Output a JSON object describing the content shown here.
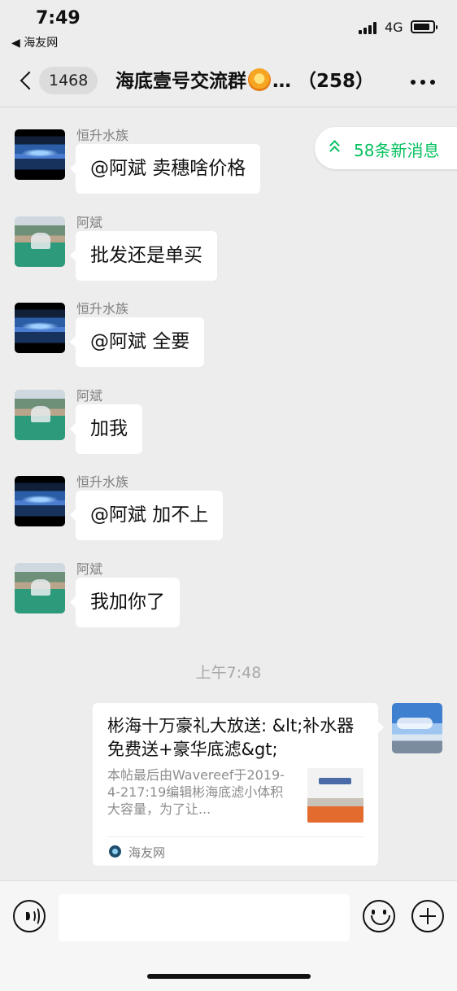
{
  "status_bar": {
    "time": "7:49",
    "back_app": "◀ 海友网",
    "network": "4G",
    "battery_level": 0.85
  },
  "nav": {
    "unread_count": "1468",
    "title": "海底壹号交流群",
    "title_emoji": "sun-flower-emoji",
    "title_ellipsis": "…",
    "member_count": "（258）"
  },
  "new_messages": {
    "label": "58条新消息",
    "icon": "double-chevron-up-icon"
  },
  "messages": [
    {
      "sender": "恒升水族",
      "text": "@阿斌 卖穗啥价格",
      "avatar": "aquarium-tank"
    },
    {
      "sender": "阿斌",
      "text": "批发还是单买",
      "avatar": "waterfall-landscape"
    },
    {
      "sender": "恒升水族",
      "text": "@阿斌 全要",
      "avatar": "aquarium-tank"
    },
    {
      "sender": "阿斌",
      "text": "加我",
      "avatar": "waterfall-landscape"
    },
    {
      "sender": "恒升水族",
      "text": "@阿斌 加不上",
      "avatar": "aquarium-tank"
    },
    {
      "sender": "阿斌",
      "text": "我加你了",
      "avatar": "waterfall-landscape"
    }
  ],
  "timestamp": "上午7:48",
  "link_card": {
    "title": "彬海十万豪礼大放送: &lt;补水器免费送+豪华底滤&gt;",
    "description": "本帖最后由Wavereef于2019-4-217:19编辑彬海底滤小体积大容量，为了让...",
    "source": "海友网"
  },
  "input_bar": {
    "voice_icon": "voice-icon",
    "emoji_icon": "emoji-icon",
    "plus_icon": "plus-icon",
    "input_value": ""
  },
  "colors": {
    "accent_green": "#07c160",
    "background": "#ededed",
    "bubble": "#ffffff"
  }
}
